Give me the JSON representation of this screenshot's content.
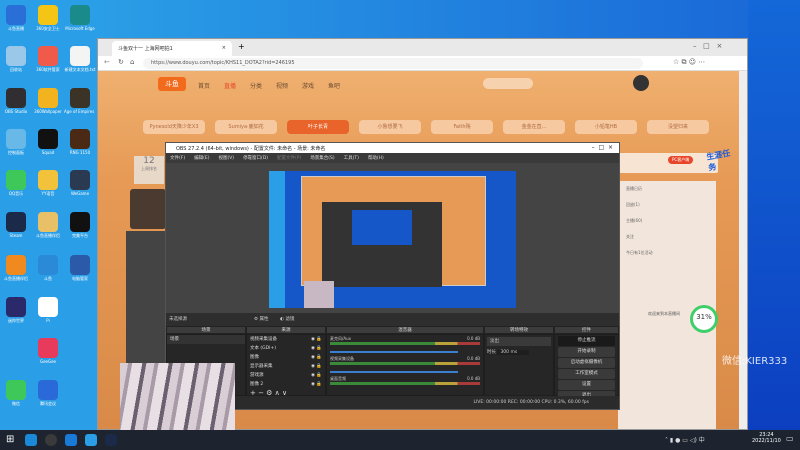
{
  "desktop": {
    "icons": [
      {
        "label": "斗鱼直播",
        "color": "#2a6fd8"
      },
      {
        "label": "360安全卫士",
        "color": "#f4c514"
      },
      {
        "label": "Microsoft Edge",
        "color": "#1a8a8a"
      },
      {
        "label": "回收站",
        "color": "#9bc8e8"
      },
      {
        "label": "360软件管家",
        "color": "#ef5a4a"
      },
      {
        "label": "新建文本文档.txt",
        "color": "#f4f4f4"
      },
      {
        "label": "OBS Studio",
        "color": "#302e31"
      },
      {
        "label": "360Wallpaper",
        "color": "#f2b41e"
      },
      {
        "label": "Age of Empires IV",
        "color": "#3b3326"
      },
      {
        "label": "控制面板",
        "color": "#68b8e8"
      },
      {
        "label": "Squad",
        "color": "#111111"
      },
      {
        "label": "RNG 1150",
        "color": "#4a2a14"
      },
      {
        "label": "QQ音乐",
        "color": "#3ec85a"
      },
      {
        "label": "YY语音",
        "color": "#f2c23a"
      },
      {
        "label": "WeGame",
        "color": "#2a3a50"
      },
      {
        "label": "Steam",
        "color": "#1b2a48"
      },
      {
        "label": "斗鱼直播伴侣",
        "color": "#e8c068"
      },
      {
        "label": "完美平台",
        "color": "#111111"
      },
      {
        "label": "斗鱼直播伴侣",
        "color": "#f08a1e"
      },
      {
        "label": "斗鱼",
        "color": "#2a8ad8"
      },
      {
        "label": "电脑管家",
        "color": "#2a5aa8"
      },
      {
        "label": "迷你世界",
        "color": "#2a2a6a"
      },
      {
        "label": "Pi",
        "color": "#ffffff"
      },
      {
        "label": "GeeGee",
        "color": "#e83a5a"
      },
      {
        "label": "微信",
        "color": "#3ec85a"
      },
      {
        "label": "腾讯会议",
        "color": "#2a6ad8"
      }
    ]
  },
  "browser": {
    "tab_title": "斗鱼双十一 上海网吧拍1",
    "url": "https://www.douyu.com/topic/KHS11_DOTA2?rid=246195",
    "nav": [
      "首页",
      "直播",
      "分类",
      "视频",
      "游戏",
      "鱼吧"
    ],
    "chips": [
      "Pynesold天降少年X3",
      "Sumiya·鹿如花",
      "叶子长青",
      "小鲁想要飞",
      "Faith殇",
      "金金在直...",
      "小铅笔HB",
      "没望归来"
    ],
    "count": "12",
    "count_label": "上周排名",
    "pc_button": "PC客户端",
    "right_items": [
      "直播日历",
      "回放(1)",
      "主播(60)",
      "关注",
      "今日有1位活动"
    ],
    "chat_welcome": "欢迎来到本直播间",
    "badge_text": "生涯任务"
  },
  "obs": {
    "title": "OBS 27.2.4 (64-bit, windows) - 配置文件: 未命名 - 场景: 未命名",
    "menu": [
      "文件(F)",
      "编辑(E)",
      "视图(V)",
      "停靠窗口(D)",
      "配置文件(P)",
      "场景集合(S)",
      "工具(T)",
      "帮助(H)"
    ],
    "no_source": "未选择源",
    "props": "属性",
    "filters": "滤镜",
    "docks": {
      "scenes": "场景",
      "sources": "来源",
      "mixer": "混音器",
      "transitions": "转场特效",
      "controls": "控件"
    },
    "scene_items": [
      "场景"
    ],
    "sources": [
      "视频采集设备",
      "文本 (GDI+)",
      "图像",
      "显示器采集",
      "游戏源",
      "图像 2"
    ],
    "mixer": [
      {
        "name": "麦克风/Aux",
        "db": "0.0 dB"
      },
      {
        "name": "视频采集设备",
        "db": "0.0 dB"
      },
      {
        "name": "桌面音频",
        "db": "0.0 dB"
      }
    ],
    "transition": "淡出",
    "duration_label": "时长",
    "duration": "300 ms",
    "controls": [
      "停止推流",
      "开始录制",
      "启动虚拟摄像机",
      "工作室模式",
      "设置",
      "退出"
    ],
    "status": "LIVE: 00:00:00    REC: 00:00:00    CPU: 0.3%, 60.00 fps"
  },
  "overlay": {
    "percent": "31%",
    "wechat": "微信:KIER333"
  },
  "taskbar": {
    "time": "23:24",
    "date": "2022/11/10",
    "ime": "中"
  }
}
